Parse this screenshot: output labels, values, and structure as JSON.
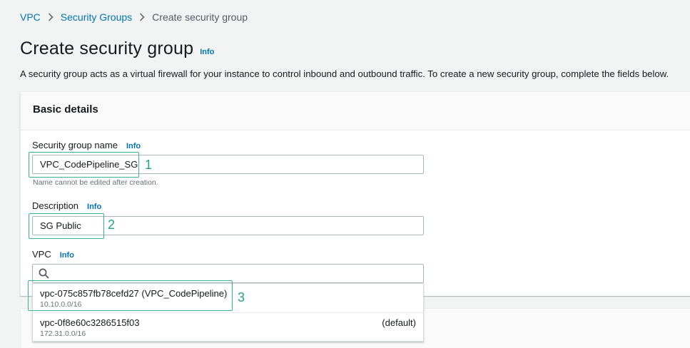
{
  "breadcrumb": {
    "items": [
      "VPC",
      "Security Groups",
      "Create security group"
    ]
  },
  "page": {
    "title": "Create security group",
    "info": "Info",
    "description": "A security group acts as a virtual firewall for your instance to control inbound and outbound traffic. To create a new security group, complete the fields below."
  },
  "basic_details": {
    "header": "Basic details",
    "name": {
      "label": "Security group name",
      "info": "Info",
      "value": "VPC_CodePipeline_SG",
      "hint": "Name cannot be edited after creation."
    },
    "description": {
      "label": "Description",
      "info": "Info",
      "value": "SG Public"
    },
    "vpc": {
      "label": "VPC",
      "info": "Info",
      "search_value": "",
      "options": [
        {
          "id": "vpc-075c857fb78cefd27 (VPC_CodePipeline)",
          "cidr": "10.10.0.0/16",
          "tag": ""
        },
        {
          "id": "vpc-0f8e60c3286515f03",
          "cidr": "172.31.0.0/16",
          "tag": "(default)"
        }
      ]
    }
  },
  "annotations": [
    "1",
    "2",
    "3"
  ],
  "colors": {
    "link": "#0073bb",
    "annotation": "#22a57e",
    "page_bg": "#f2f3f3"
  }
}
